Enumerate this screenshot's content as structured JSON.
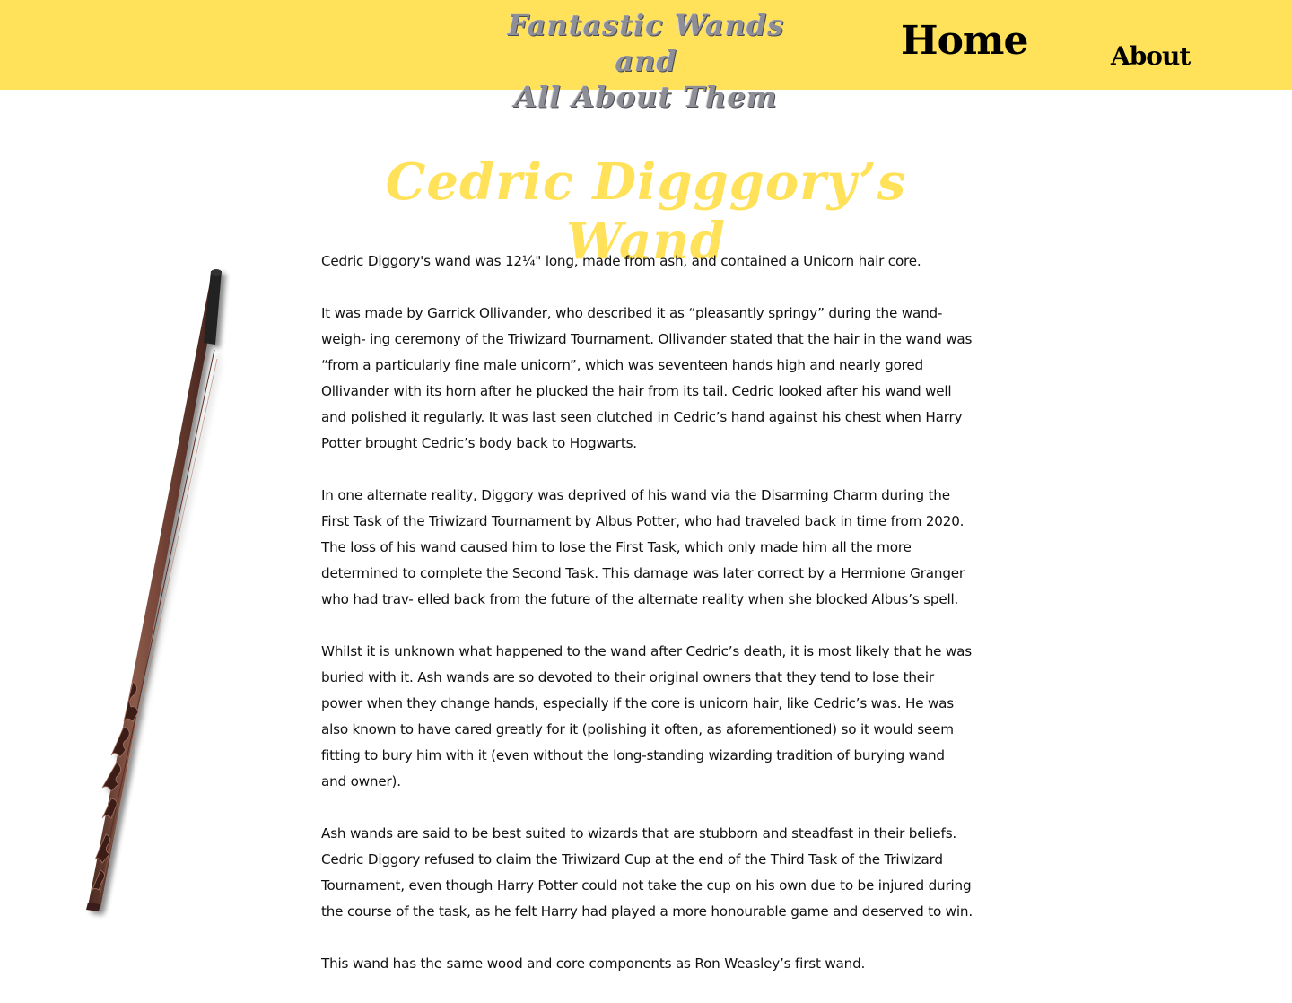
{
  "header": {
    "title_line1": "Fantastic Wands and",
    "title_line2": "All About Them",
    "nav": {
      "home": "Home",
      "about": "About"
    },
    "background_color": "#ffe15a"
  },
  "main": {
    "heading": "Cedric Digggory’s Wand",
    "heading_color": "#ffe15a",
    "wand_image_icon": "wand-image",
    "paragraphs": [
      "Cedric Diggory's wand was 12¼\" long, made from ash, and contained a Unicorn hair core.",
      "It was made by Garrick Ollivander, who described it as “pleasantly springy” during the wand-weigh- ing ceremony of the Triwizard Tournament. Ollivander stated that the hair in the wand was “from a particularly fine male unicorn”, which was seventeen hands high and nearly gored Ollivander with its horn after he plucked the hair from its tail. Cedric looked after his wand well and polished it regularly. It was last seen clutched in Cedric’s hand against his chest when Harry Potter brought Cedric’s body back to Hogwarts.",
      "In one alternate reality, Diggory was deprived of his wand via the Disarming Charm during the First Task of the Triwizard Tournament by Albus Potter, who had traveled back in time from 2020. The loss of his wand caused him to lose the First Task, which only made him all the more determined to complete the Second Task. This damage was later correct by a Hermione Granger who had trav- elled back from the future of the alternate reality when she blocked Albus’s spell.",
      "Whilst it is unknown what happened to the wand after Cedric’s death, it is most likely that he was buried with it. Ash wands are so devoted to their original owners that they tend to lose their power when they change hands, especially if the core is unicorn hair, like Cedric’s was. He was also known to have cared greatly for it (polishing it often, as aforementioned) so it would seem fitting to bury him with it (even without the long-standing wizarding tradition of burying wand and owner).",
      "Ash wands are said to be best suited to wizards that are stubborn and steadfast in their beliefs. Cedric Diggory refused to claim the Triwizard Cup at the end of the Third Task of the Triwizard Tournament, even though Harry Potter could not take the cup on his own due to be injured during the course of the task, as he felt Harry had played a more honourable game and deserved to win.",
      "This wand has the same wood and core components as Ron Weasley’s first wand."
    ]
  }
}
